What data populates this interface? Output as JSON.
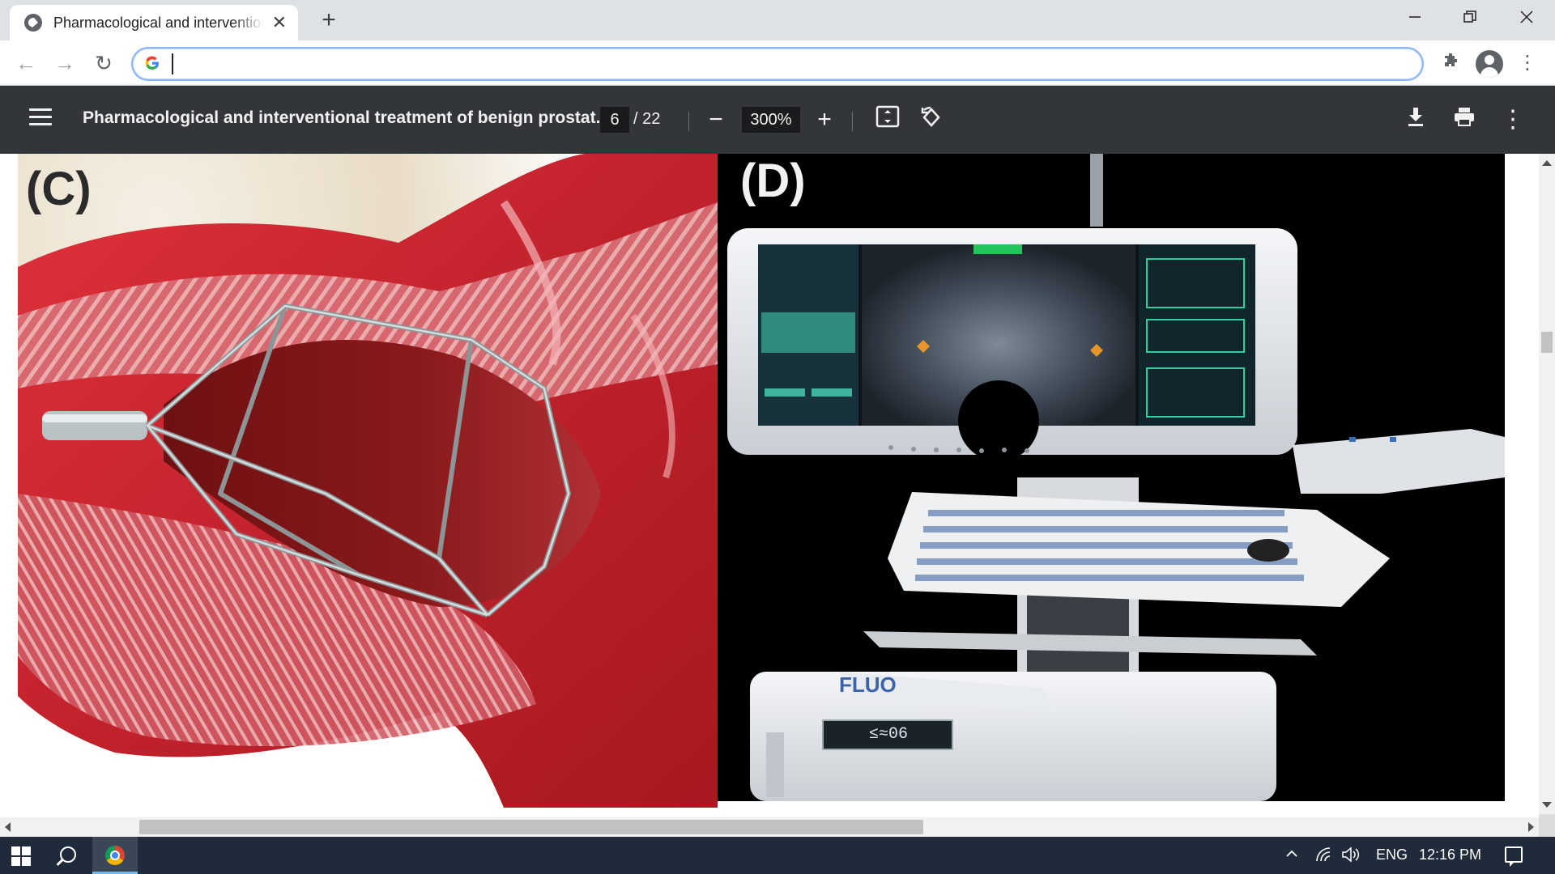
{
  "browser": {
    "tab": {
      "title": "Pharmacological and interventional treatment of benign prostatic hyperplasia",
      "favicon": "globe-icon",
      "close_glyph": "✕"
    },
    "new_tab_glyph": "+",
    "window_controls": {
      "minimize": "—",
      "restore": "❐",
      "close": "✕"
    },
    "nav": {
      "back": "←",
      "forward": "→",
      "reload": "↻"
    },
    "omnibox": {
      "value": "",
      "placeholder": "",
      "icon": "google-g-icon",
      "icon_glyph": "G"
    },
    "extensions_glyph": "✱",
    "menu_glyph": "⋮"
  },
  "pdf_viewer": {
    "title": "Pharmacological and interventional treatment of benign prostat...",
    "page_current": "6",
    "page_total": "/ 22",
    "zoom_out_glyph": "−",
    "zoom": "300%",
    "zoom_in_glyph": "+",
    "rotate_glyph": "⟲",
    "download_glyph": "⬇",
    "print_glyph": "⎙",
    "more_glyph": "⋮"
  },
  "document": {
    "panels": [
      {
        "label": "(C)",
        "content": "illustration"
      },
      {
        "label": "(D)",
        "content": "photo"
      }
    ],
    "monitor_readout": "≤≈06"
  },
  "taskbar": {
    "tray": {
      "chevron": "^",
      "network_glyph": "◠",
      "volume_glyph": "🔈",
      "language": "ENG"
    },
    "time": "12:16 PM"
  },
  "colors": {
    "tabstrip": "#dee1e6",
    "pdf_toolbar": "#323639",
    "taskbar": "#1f2a3a",
    "omnibox_focus": "#8ab4f8",
    "tissue_red": "#c8232e",
    "tissue_dark": "#7d1416"
  }
}
